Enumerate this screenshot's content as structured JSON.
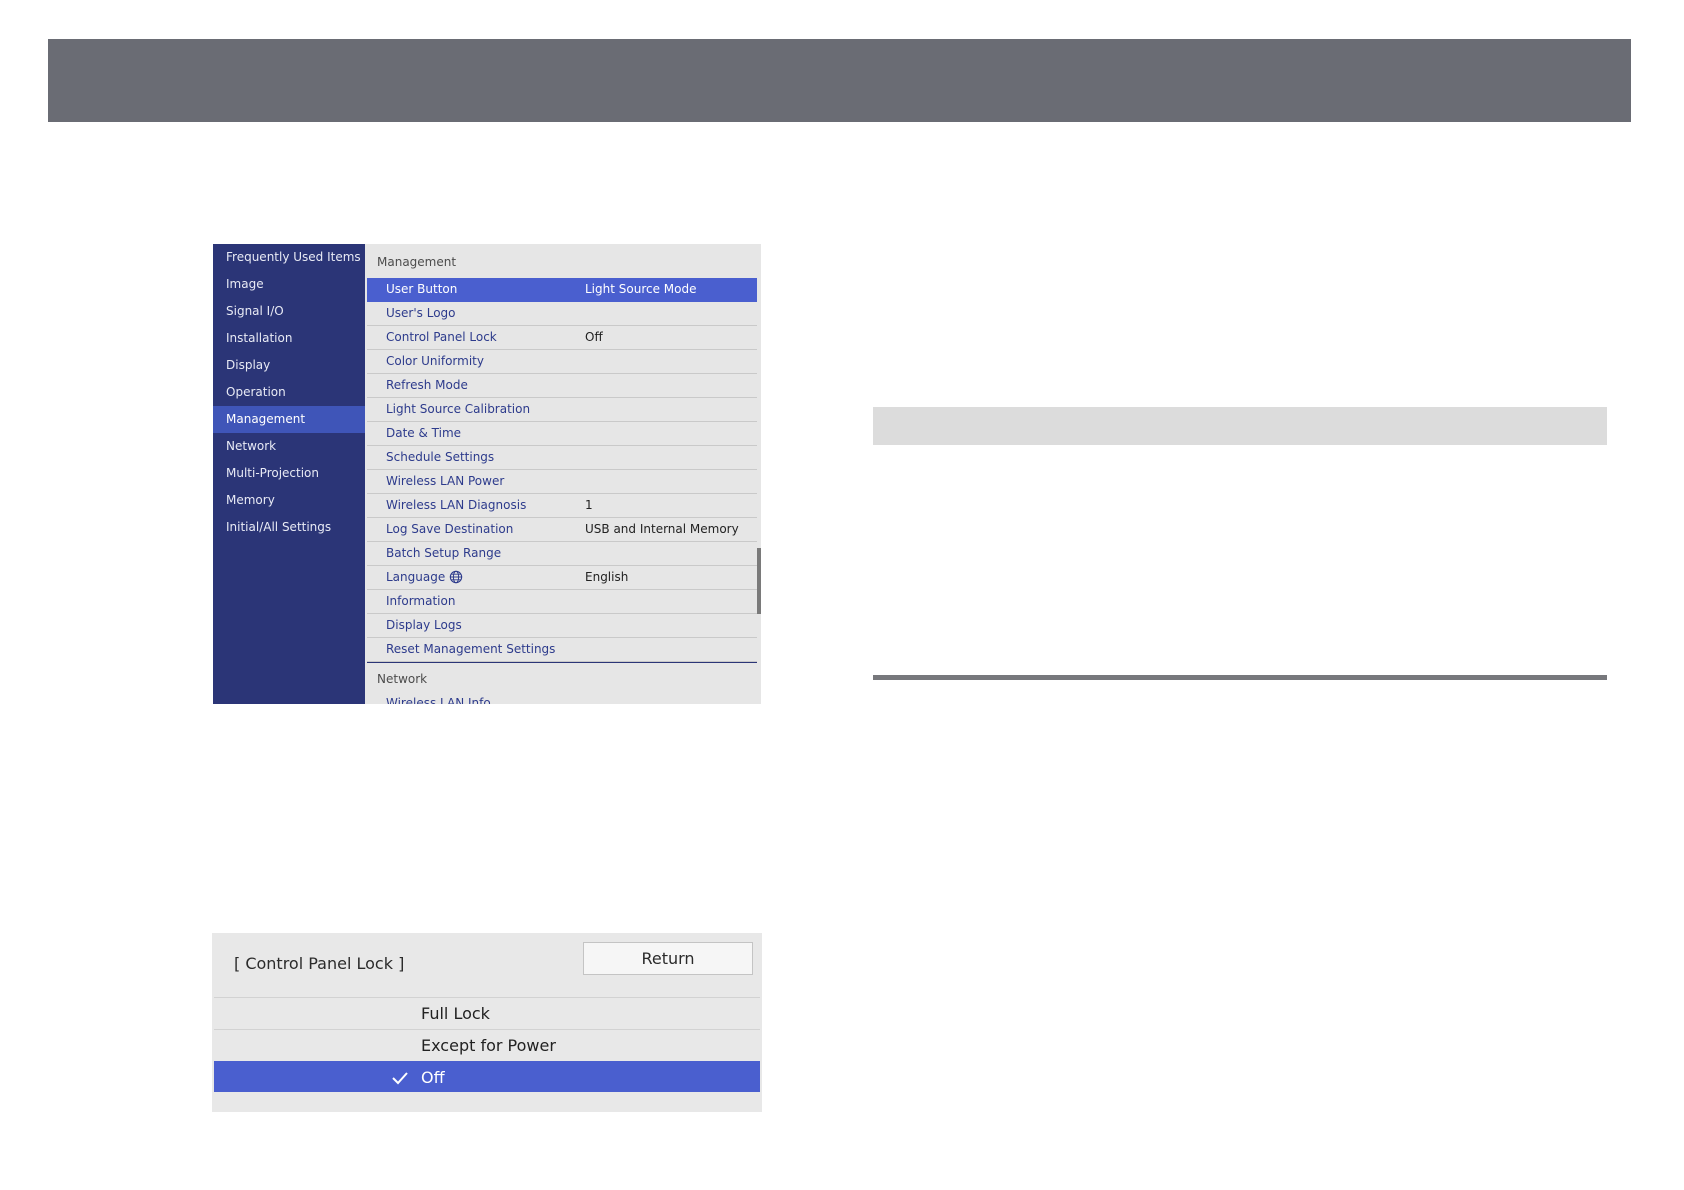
{
  "menu": {
    "sidebar_items": [
      {
        "label": "Frequently Used Items"
      },
      {
        "label": "Image"
      },
      {
        "label": "Signal I/O"
      },
      {
        "label": "Installation"
      },
      {
        "label": "Display"
      },
      {
        "label": "Operation"
      },
      {
        "label": "Management"
      },
      {
        "label": "Network"
      },
      {
        "label": "Multi-Projection"
      },
      {
        "label": "Memory"
      },
      {
        "label": "Initial/All Settings"
      }
    ],
    "active_sidebar_item": "Management",
    "section_title": "Management",
    "rows": [
      {
        "label": "User Button",
        "value": "Light Source Mode"
      },
      {
        "label": "User's Logo",
        "value": ""
      },
      {
        "label": "Control Panel Lock",
        "value": "Off"
      },
      {
        "label": "Color Uniformity",
        "value": ""
      },
      {
        "label": "Refresh Mode",
        "value": ""
      },
      {
        "label": "Light Source Calibration",
        "value": ""
      },
      {
        "label": "Date & Time",
        "value": ""
      },
      {
        "label": "Schedule Settings",
        "value": ""
      },
      {
        "label": "Wireless LAN Power",
        "value": ""
      },
      {
        "label": "Wireless LAN Diagnosis",
        "value": "1"
      },
      {
        "label": "Log Save Destination",
        "value": "USB and Internal Memory"
      },
      {
        "label": "Batch Setup Range",
        "value": ""
      },
      {
        "label": "Language",
        "value": "English"
      },
      {
        "label": "Information",
        "value": ""
      },
      {
        "label": "Display Logs",
        "value": ""
      },
      {
        "label": "Reset Management Settings",
        "value": ""
      }
    ],
    "selected_row": "User Button",
    "next_section_title": "Network",
    "next_section_first_row": "Wireless LAN Info"
  },
  "dialog": {
    "title": "[ Control Panel Lock ]",
    "return_label": "Return",
    "options": [
      {
        "label": "Full Lock"
      },
      {
        "label": "Except for Power"
      },
      {
        "label": "Off"
      }
    ],
    "selected_option": "Off"
  },
  "colors": {
    "header_bar": "#6a6c74",
    "sidebar_bg": "#2b3577",
    "selection": "#4a5fcf",
    "menu_link_text": "#2d3b8c"
  }
}
